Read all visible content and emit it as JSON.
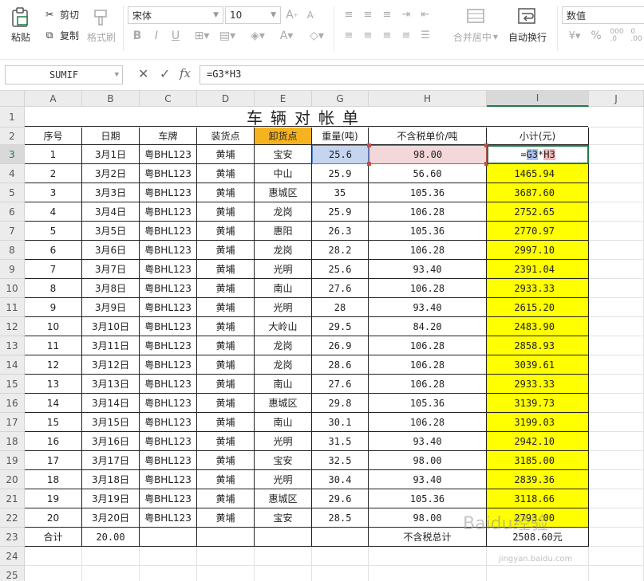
{
  "ribbon": {
    "paste": "粘贴",
    "cut": "剪切",
    "copy": "复制",
    "format_painter": "格式刷",
    "font_name": "宋体",
    "font_size": "10",
    "merge_center": "合并居中",
    "wrap_text": "自动换行",
    "number_format": "数值"
  },
  "formula_bar": {
    "name_box": "SUMIF",
    "fx": "fx",
    "formula": "=G3*H3"
  },
  "columns": [
    "A",
    "B",
    "C",
    "D",
    "E",
    "G",
    "H",
    "I",
    "J"
  ],
  "row_numbers": [
    "1",
    "2",
    "3",
    "4",
    "5",
    "6",
    "7",
    "8",
    "9",
    "10",
    "11",
    "12",
    "13",
    "14",
    "15",
    "16",
    "17",
    "18",
    "19",
    "20",
    "21",
    "22",
    "23",
    "24",
    "25",
    "26"
  ],
  "sheet": {
    "title": "车辆对帐单",
    "headers": [
      "序号",
      "日期",
      "车牌",
      "装货点",
      "卸货点",
      "重量(吨)",
      "不含税单价/吨",
      "小计(元)"
    ],
    "rows": [
      [
        "1",
        "3月1日",
        "粤BHL123",
        "黄埔",
        "宝安",
        "25.6",
        "98.00",
        "=G3*H3"
      ],
      [
        "2",
        "3月2日",
        "粤BHL123",
        "黄埔",
        "中山",
        "25.9",
        "56.60",
        "1465.94"
      ],
      [
        "3",
        "3月3日",
        "粤BHL123",
        "黄埔",
        "惠城区",
        "35",
        "105.36",
        "3687.60"
      ],
      [
        "4",
        "3月4日",
        "粤BHL123",
        "黄埔",
        "龙岗",
        "25.9",
        "106.28",
        "2752.65"
      ],
      [
        "5",
        "3月5日",
        "粤BHL123",
        "黄埔",
        "惠阳",
        "26.3",
        "105.36",
        "2770.97"
      ],
      [
        "6",
        "3月6日",
        "粤BHL123",
        "黄埔",
        "龙岗",
        "28.2",
        "106.28",
        "2997.10"
      ],
      [
        "7",
        "3月7日",
        "粤BHL123",
        "黄埔",
        "光明",
        "25.6",
        "93.40",
        "2391.04"
      ],
      [
        "8",
        "3月8日",
        "粤BHL123",
        "黄埔",
        "南山",
        "27.6",
        "106.28",
        "2933.33"
      ],
      [
        "9",
        "3月9日",
        "粤BHL123",
        "黄埔",
        "光明",
        "28",
        "93.40",
        "2615.20"
      ],
      [
        "10",
        "3月10日",
        "粤BHL123",
        "黄埔",
        "大岭山",
        "29.5",
        "84.20",
        "2483.90"
      ],
      [
        "11",
        "3月11日",
        "粤BHL123",
        "黄埔",
        "龙岗",
        "26.9",
        "106.28",
        "2858.93"
      ],
      [
        "12",
        "3月12日",
        "粤BHL123",
        "黄埔",
        "龙岗",
        "28.6",
        "106.28",
        "3039.61"
      ],
      [
        "13",
        "3月13日",
        "粤BHL123",
        "黄埔",
        "南山",
        "27.6",
        "106.28",
        "2933.33"
      ],
      [
        "14",
        "3月14日",
        "粤BHL123",
        "黄埔",
        "惠城区",
        "29.8",
        "105.36",
        "3139.73"
      ],
      [
        "15",
        "3月15日",
        "粤BHL123",
        "黄埔",
        "南山",
        "30.1",
        "106.28",
        "3199.03"
      ],
      [
        "16",
        "3月16日",
        "粤BHL123",
        "黄埔",
        "光明",
        "31.5",
        "93.40",
        "2942.10"
      ],
      [
        "17",
        "3月17日",
        "粤BHL123",
        "黄埔",
        "宝安",
        "32.5",
        "98.00",
        "3185.00"
      ],
      [
        "18",
        "3月18日",
        "粤BHL123",
        "黄埔",
        "光明",
        "30.4",
        "93.40",
        "2839.36"
      ],
      [
        "19",
        "3月19日",
        "粤BHL123",
        "黄埔",
        "惠城区",
        "29.6",
        "105.36",
        "3118.66"
      ],
      [
        "20",
        "3月20日",
        "粤BHL123",
        "黄埔",
        "宝安",
        "28.5",
        "98.00",
        "2793.00"
      ]
    ],
    "total_label": "合计",
    "total_weight": "20.00",
    "tax_total_label": "不含税总计",
    "tax_total_value": "2508.60",
    "tax_total_unit": "元",
    "header_highlight_color": "#f5b320",
    "column_fill_color": "#ffff00"
  },
  "watermark": "Baidu经验",
  "watermark_url": "jingyan.baidu.com"
}
